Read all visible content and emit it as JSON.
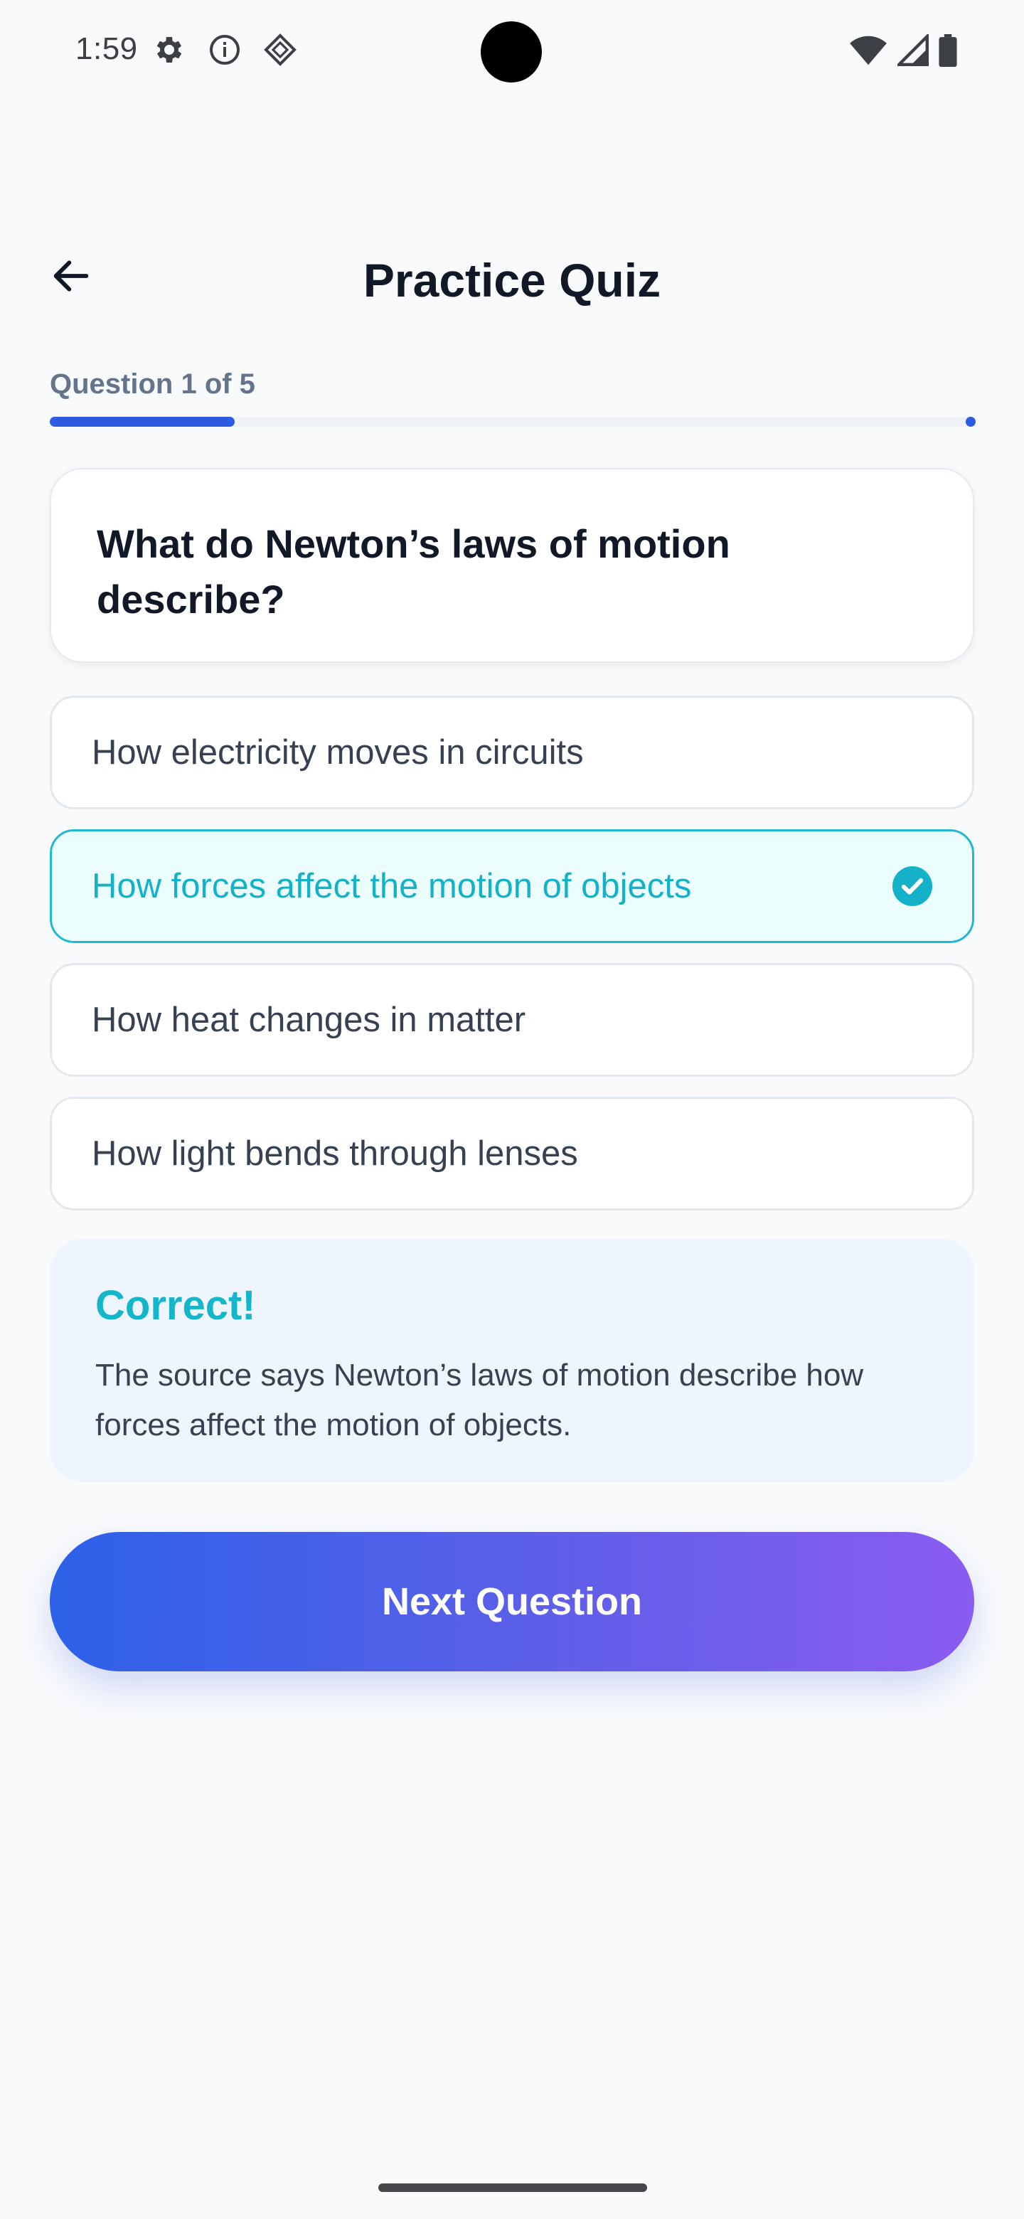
{
  "status_bar": {
    "time": "1:59",
    "left_icons": [
      "settings-gear-icon",
      "info-icon",
      "diamond-app-icon"
    ],
    "right_icons": [
      "wifi-icon",
      "cellular-signal-icon",
      "battery-icon"
    ]
  },
  "header": {
    "back_icon": "arrow-left-icon",
    "title": "Practice Quiz"
  },
  "progress": {
    "label": "Question 1 of 5",
    "current": 1,
    "total": 5,
    "fraction": 0.2
  },
  "question": {
    "text": "What do Newton’s laws of motion describe?"
  },
  "options": [
    {
      "label": "How electricity moves in circuits",
      "selected": false
    },
    {
      "label": "How forces affect the motion of objects",
      "selected": true
    },
    {
      "label": "How heat changes in matter",
      "selected": false
    },
    {
      "label": "How light bends through lenses",
      "selected": false
    }
  ],
  "feedback": {
    "title": "Correct!",
    "text": "The source says Newton’s laws of motion describe how forces affect the motion of objects."
  },
  "next_button": {
    "label": "Next Question"
  },
  "colors": {
    "accent_blue": "#2d5be3",
    "correct_teal": "#15b6c9",
    "gradient_start": "#2c61e8",
    "gradient_end": "#8a5cf1",
    "background": "#f8fafc"
  }
}
